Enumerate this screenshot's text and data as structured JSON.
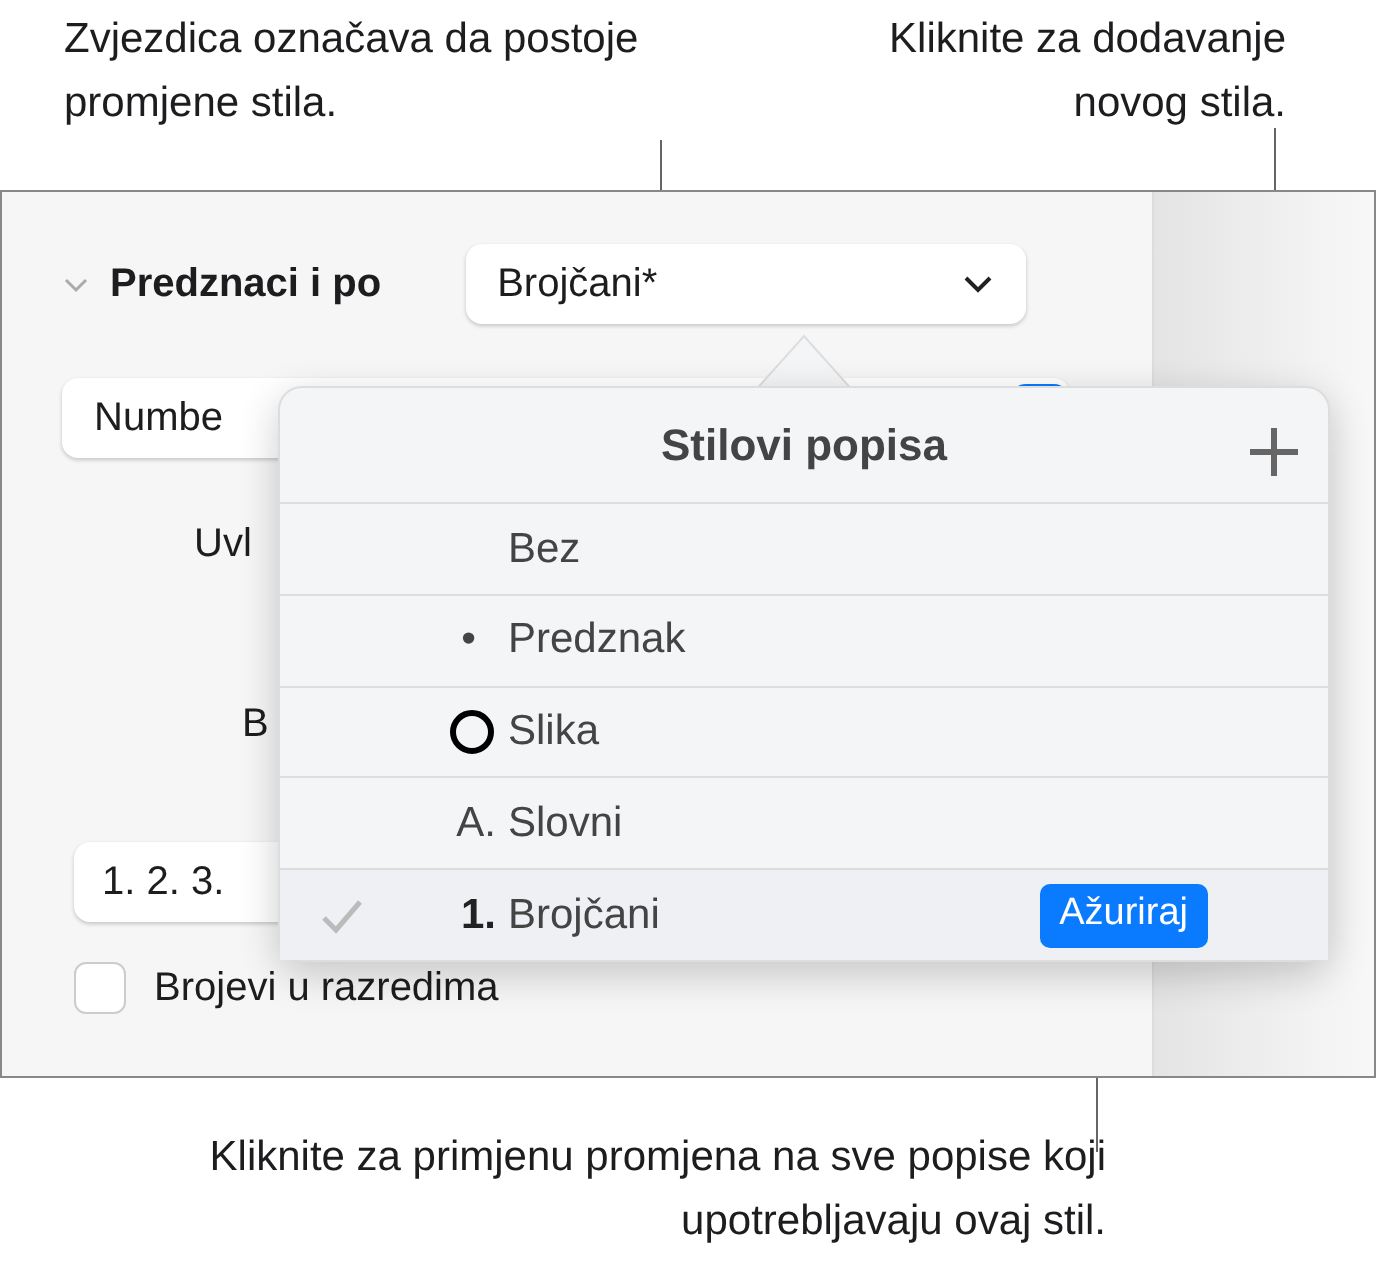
{
  "callouts": [
    {
      "text": "Zvjezdica označava da postoje promjene stila."
    },
    {
      "text": "Kliknite za dodavanje novog stila."
    },
    {
      "text": "Kliknite za primjenu promjena na sve popise koji upotrebljavaju ovaj stil."
    }
  ],
  "section": {
    "title": "Predznaci i po",
    "expanded": true,
    "style_popup": "Brojčani*"
  },
  "fields": {
    "list_type": "Numbe",
    "indent_label": "Uvl",
    "label_b": "B",
    "format": "1. 2. 3."
  },
  "checkbox": {
    "label": "Brojevi u razredima",
    "checked": false
  },
  "popover": {
    "title": "Stilovi popisa",
    "items": [
      {
        "kind": "none",
        "label": "Bez",
        "selected": false
      },
      {
        "kind": "bullet",
        "mark": "•",
        "label": "Predznak",
        "selected": false
      },
      {
        "kind": "image",
        "label": "Slika",
        "selected": false
      },
      {
        "kind": "letter",
        "mark": "A.",
        "label": "Slovni",
        "selected": false
      },
      {
        "kind": "number",
        "mark": "1.",
        "label": "Brojčani",
        "selected": true
      }
    ],
    "update_button": "Ažuriraj"
  }
}
